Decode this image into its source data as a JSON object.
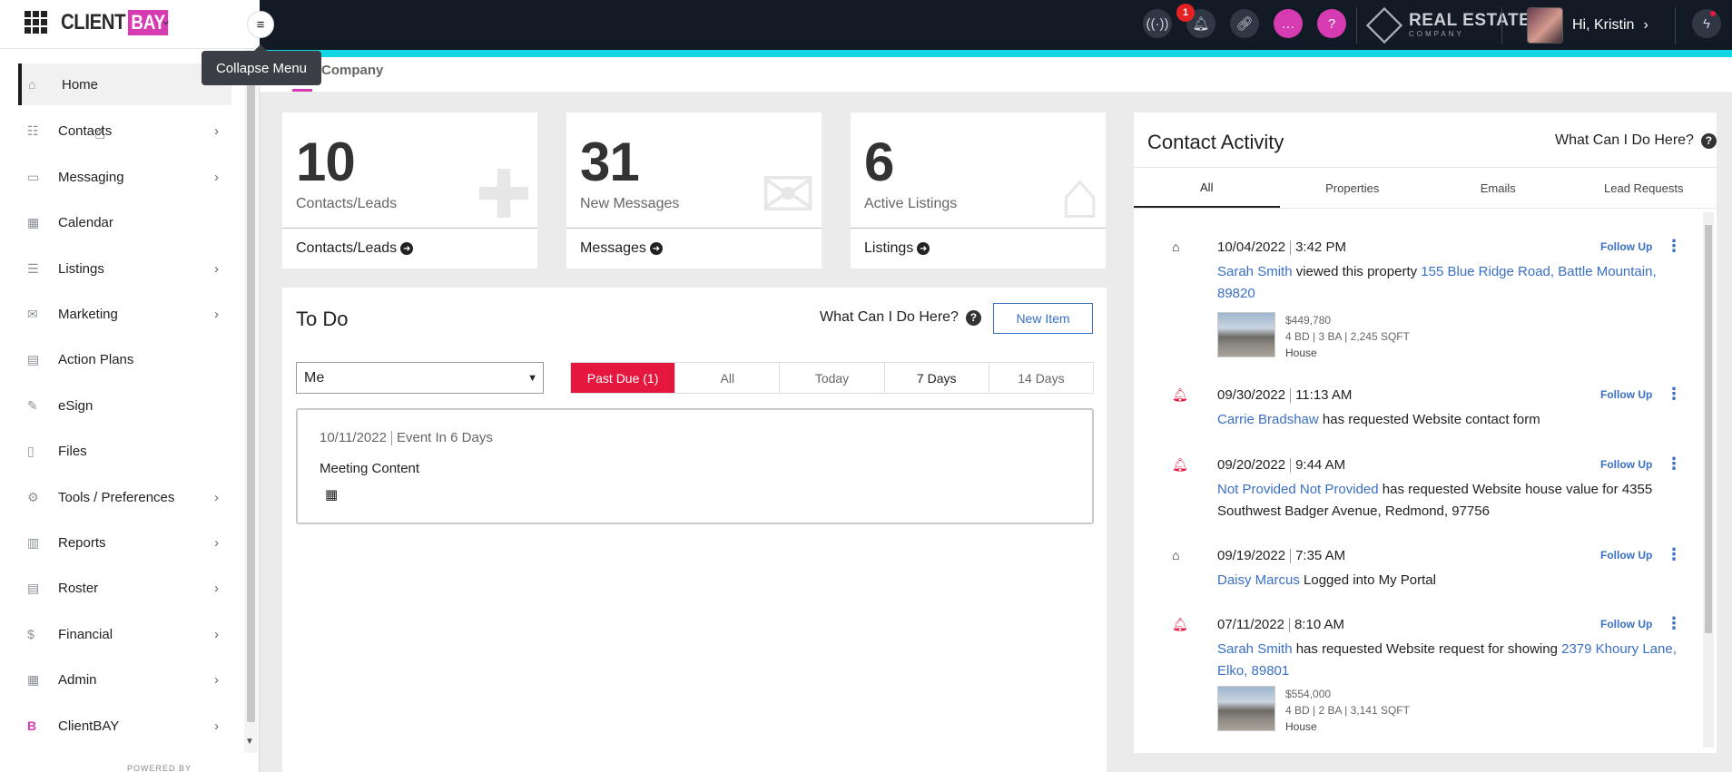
{
  "header": {
    "notifications_badge": "1",
    "brand_logo": {
      "line1": "REAL ESTATE",
      "line2": "COMPANY"
    },
    "greeting": "Hi, Kristin",
    "icons": [
      "radio-waves-icon",
      "bell-icon",
      "link-icon",
      "chat-icon",
      "help-icon",
      "lightning-icon"
    ]
  },
  "sidebar": {
    "logo_client": "CLIENT",
    "logo_bay": "BAY",
    "tooltip": "Collapse Menu",
    "footer": "POWERED BY",
    "items": [
      {
        "label": "Home",
        "icon": "⌂"
      },
      {
        "label": "Contacts",
        "icon": "☷",
        "chevron": "›"
      },
      {
        "label": "Messaging",
        "icon": "▭",
        "chevron": "›"
      },
      {
        "label": "Calendar",
        "icon": "▦"
      },
      {
        "label": "Listings",
        "icon": "☰",
        "chevron": "›"
      },
      {
        "label": "Marketing",
        "icon": "✉",
        "chevron": "›"
      },
      {
        "label": "Action Plans",
        "icon": "▤"
      },
      {
        "label": "eSign",
        "icon": "✎"
      },
      {
        "label": "Files",
        "icon": "▯"
      },
      {
        "label": "Tools / Preferences",
        "icon": "⚙",
        "chevron": "›"
      },
      {
        "label": "Reports",
        "icon": "▥",
        "chevron": "›"
      },
      {
        "label": "Roster",
        "icon": "▤",
        "chevron": "›"
      },
      {
        "label": "Financial",
        "icon": "$",
        "chevron": "›"
      },
      {
        "label": "Admin",
        "icon": "▦",
        "chevron": "›"
      },
      {
        "label": "ClientBAY",
        "icon": "B",
        "chevron": "›"
      }
    ]
  },
  "breadcrumb": {
    "current": "Company"
  },
  "stats": [
    {
      "number": "10",
      "label": "Contacts/Leads",
      "link": "Contacts/Leads",
      "icon": "puzzle-icon"
    },
    {
      "number": "31",
      "label": "New Messages",
      "link": "Messages",
      "icon": "envelope-icon"
    },
    {
      "number": "6",
      "label": "Active Listings",
      "link": "Listings",
      "icon": "house-icon"
    }
  ],
  "todo": {
    "title": "To Do",
    "help": "What Can I Do Here?",
    "new_item": "New Item",
    "assignee_select": "Me",
    "filters": [
      "Past Due (1)",
      "All",
      "Today",
      "7 Days",
      "14 Days"
    ],
    "event": {
      "date": "10/11/2022",
      "when": "Event In 6 Days",
      "title": "Meeting Content"
    }
  },
  "activity": {
    "title": "Contact Activity",
    "help": "What Can I Do Here?",
    "tabs": [
      "All",
      "Properties",
      "Emails",
      "Lead Requests"
    ],
    "follow_up": "Follow Up",
    "items": [
      {
        "icon": "home",
        "date": "10/04/2022",
        "time": "3:42 PM",
        "person": "Sarah Smith",
        "action": " viewed this property ",
        "link": "155 Blue Ridge Road, Battle Mountain, 89820",
        "property": {
          "price": "$449,780",
          "specs": "4 BD | 3 BA | 2,245 SQFT",
          "type": "House"
        }
      },
      {
        "icon": "bell",
        "date": "09/30/2022",
        "time": "11:13 AM",
        "person": "Carrie Bradshaw",
        "action": " has requested Website contact form",
        "link": ""
      },
      {
        "icon": "bell",
        "date": "09/20/2022",
        "time": "9:44 AM",
        "person": "Not Provided Not Provided",
        "action": " has requested Website house value for 4355 Southwest Badger Avenue, Redmond, 97756",
        "link": ""
      },
      {
        "icon": "home",
        "date": "09/19/2022",
        "time": "7:35 AM",
        "person": "Daisy Marcus",
        "action": " Logged into My Portal",
        "link": ""
      },
      {
        "icon": "bell",
        "date": "07/11/2022",
        "time": "8:10 AM",
        "person": "Sarah Smith",
        "action": " has requested Website request for showing ",
        "link": "2379 Khoury Lane, Elko, 89801",
        "property": {
          "price": "$554,000",
          "specs": "4 BD | 2 BA | 3,141 SQFT",
          "type": "House"
        }
      }
    ]
  },
  "colors": {
    "accent_pink": "#d63bb2",
    "accent_red": "#e5173f",
    "link_blue": "#3a6fc4",
    "topbar": "#121a26",
    "cyan": "#12d6e6"
  }
}
